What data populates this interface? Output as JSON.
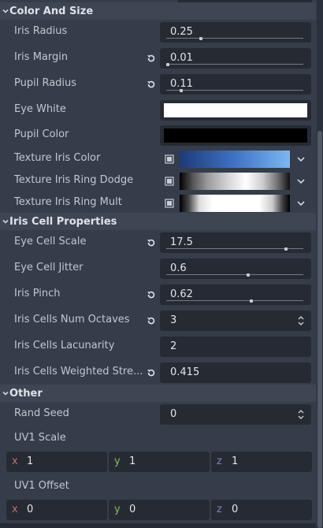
{
  "sections": {
    "color_and_size": "Color And Size",
    "iris_cell_properties": "Iris Cell Properties",
    "other": "Other"
  },
  "props": {
    "iris_radius": {
      "label": "Iris Radius",
      "value": "0.25",
      "level": 0.25
    },
    "iris_margin": {
      "label": "Iris Margin",
      "value": "0.01",
      "level": 0.01
    },
    "pupil_radius": {
      "label": "Pupil Radius",
      "value": "0.11",
      "level": 0.11
    },
    "eye_white": {
      "label": "Eye White",
      "color": "#ffffff"
    },
    "pupil_color": {
      "label": "Pupil Color",
      "color": "#000000"
    },
    "texture_iris_color": {
      "label": "Texture Iris Color"
    },
    "texture_iris_ring_dodge": {
      "label": "Texture Iris Ring Dodge"
    },
    "texture_iris_ring_mult": {
      "label": "Texture Iris Ring Mult"
    },
    "eye_cell_scale": {
      "label": "Eye Cell Scale",
      "value": "17.5",
      "level": 0.875
    },
    "eye_cell_jitter": {
      "label": "Eye Cell Jitter",
      "value": "0.6",
      "level": 0.6
    },
    "iris_pinch": {
      "label": "Iris Pinch",
      "value": "0.62",
      "level": 0.62
    },
    "iris_cells_num_octaves": {
      "label": "Iris Cells Num Octaves",
      "value": "3"
    },
    "iris_cells_lacunarity": {
      "label": "Iris Cells Lacunarity",
      "value": "2"
    },
    "iris_cells_weighted_strength": {
      "label": "Iris Cells Weighted Stre...",
      "value": "0.415"
    },
    "rand_seed": {
      "label": "Rand Seed",
      "value": "0"
    },
    "uv1_scale": {
      "label": "UV1 Scale",
      "x": "1",
      "y": "1",
      "z": "1"
    },
    "uv1_offset": {
      "label": "UV1 Offset",
      "x": "0",
      "y": "0",
      "z": "0"
    }
  },
  "axis_labels": {
    "x": "x",
    "y": "y",
    "z": "z"
  },
  "icons": {
    "section_toggle": "chevron-down-icon",
    "revert": "revert-icon",
    "spinner": "spin-arrows-icon",
    "texture": "texture-icon",
    "dropdown": "dropdown-chevron-icon"
  },
  "colors": {
    "texture_iris_color_start": "#1e3a78",
    "texture_iris_color_end": "#7ab8f2"
  }
}
